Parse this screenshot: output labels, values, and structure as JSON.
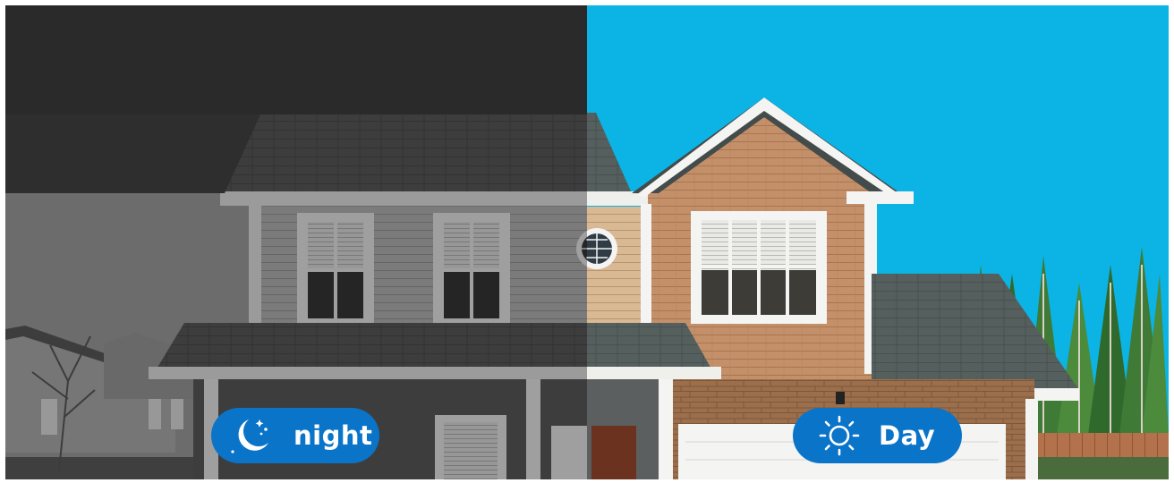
{
  "scene": {
    "description_colors": {
      "night_sky": "#2b2b2b",
      "day_sky": "#0bb4e4",
      "siding_day": "#c8956a",
      "badge": "#0a74c9"
    }
  },
  "badges": {
    "night": {
      "label": "night",
      "icon": "moon-stars-icon"
    },
    "day": {
      "label": "Day",
      "icon": "sun-icon"
    }
  }
}
